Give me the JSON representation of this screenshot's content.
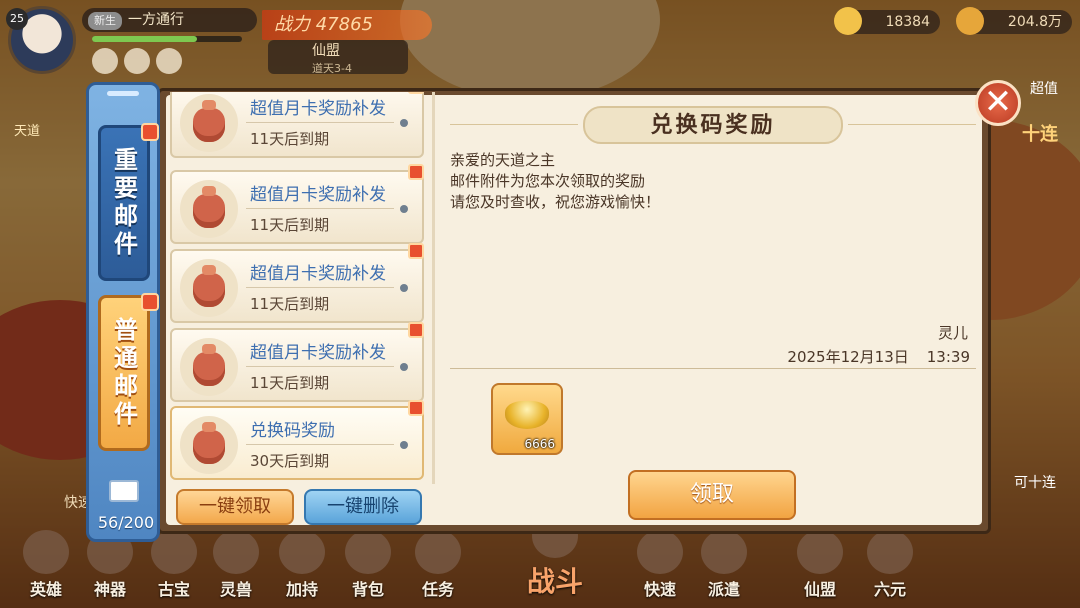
{
  "hud": {
    "level": "25",
    "rank": "新生",
    "player_name": "一方通行",
    "exp_fraction": 0.7,
    "power_label": "战力",
    "power_value": "47865",
    "alliance_name": "仙盟",
    "alliance_sub": "道天3-4",
    "currency_1": "18384",
    "currency_2": "204.8万",
    "side_label": "超值",
    "side_label_2": "十连",
    "side_label_3": "天道",
    "side_label_4": "可十连",
    "side_label_5": "快速"
  },
  "bottom_nav": [
    {
      "label": "英雄"
    },
    {
      "label": "神器"
    },
    {
      "label": "古宝"
    },
    {
      "label": "灵兽"
    },
    {
      "label": "加持"
    },
    {
      "label": "背包"
    },
    {
      "label": "任务"
    },
    {
      "label": "战斗"
    },
    {
      "label": "快速"
    },
    {
      "label": "派遣"
    },
    {
      "label": "仙盟"
    },
    {
      "label": "六元"
    }
  ],
  "tabs": {
    "important": "重要邮件",
    "normal": "普通邮件",
    "active": "normal",
    "mail_count": "56/200"
  },
  "mail_list": [
    {
      "title": "超值月卡奖励补发",
      "expire": "11天后到期"
    },
    {
      "title": "超值月卡奖励补发",
      "expire": "11天后到期"
    },
    {
      "title": "超值月卡奖励补发",
      "expire": "11天后到期"
    },
    {
      "title": "超值月卡奖励补发",
      "expire": "11天后到期"
    },
    {
      "title": "兑换码奖励",
      "expire": "30天后到期"
    }
  ],
  "actions": {
    "claim_all": "一键领取",
    "delete_all": "一键删除"
  },
  "detail": {
    "title": "兑换码奖励",
    "greeting": "亲爱的天道之主",
    "line1": "邮件附件为您本次领取的奖励",
    "line2": "请您及时查收，祝您游戏愉快！",
    "sender": "灵儿",
    "date": "2025年12月13日",
    "time": "13:39",
    "reward_amount": "6666",
    "reward_icon": "gold-ingot-icon",
    "claim_label": "领取"
  },
  "colors": {
    "title_blue": "#3e6fb0",
    "tab_blue": "#4f86c2",
    "tab_orange": "#f2a945",
    "claim_orange": "#f2a442"
  }
}
